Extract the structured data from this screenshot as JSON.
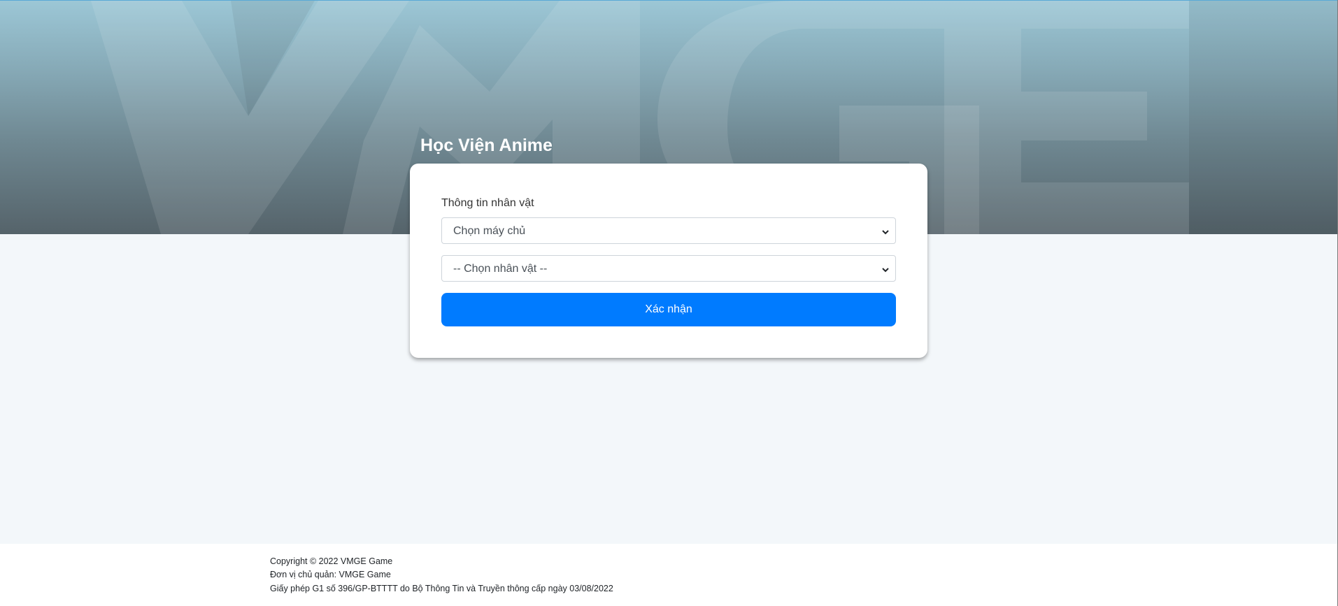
{
  "header": {
    "title": "Học Viện Anime",
    "watermark_text": "VMGE"
  },
  "form": {
    "section_label": "Thông tin nhân vật",
    "server_select": {
      "value": "Chọn máy chủ"
    },
    "character_select": {
      "value": "-- Chọn nhân vật --"
    },
    "confirm_label": "Xác nhận"
  },
  "footer": {
    "copyright": "Copyright © 2022 VMGE Game",
    "owner": "Đơn vị chủ quản: VMGE Game",
    "license": "Giấy phép G1 số 396/GP-BTTTT do Bộ Thông Tin và Truyền thông cấp ngày 03/08/2022"
  },
  "colors": {
    "primary_button": "#007bff",
    "page_background": "#f3f7fa",
    "banner_top": "#9cc7d6",
    "banner_bottom": "#55636a"
  }
}
